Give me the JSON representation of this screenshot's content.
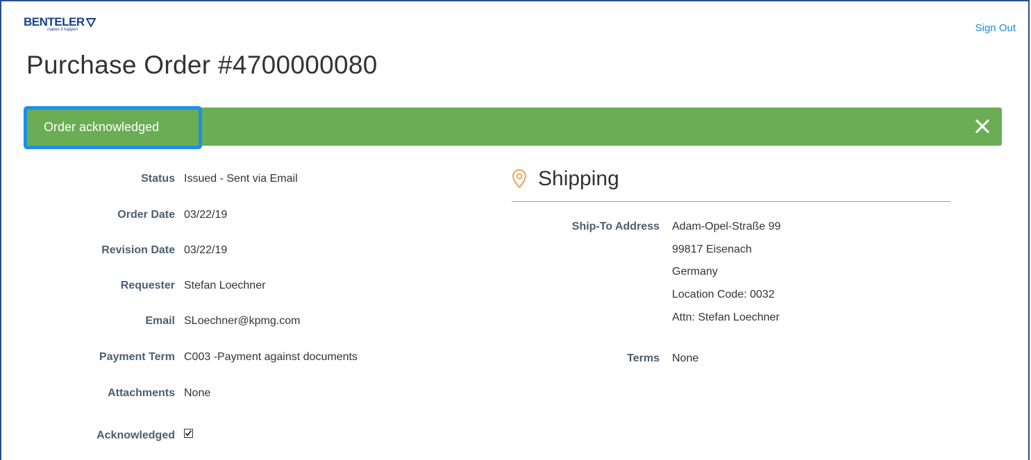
{
  "brand": {
    "name": "BENTELER",
    "tagline": "makes it happen"
  },
  "header": {
    "sign_out": "Sign Out",
    "title": "Purchase Order #4700000080"
  },
  "banner": {
    "message": "Order acknowledged",
    "color": "#6aad55",
    "highlight": "#1d8fe6"
  },
  "details": {
    "status_label": "Status",
    "status": "Issued - Sent via Email",
    "order_date_label": "Order Date",
    "order_date": "03/22/19",
    "revision_date_label": "Revision Date",
    "revision_date": "03/22/19",
    "requester_label": "Requester",
    "requester": "Stefan Loechner",
    "email_label": "Email",
    "email": "SLoechner@kpmg.com",
    "payment_term_label": "Payment Term",
    "payment_term": "C003 -Payment against documents",
    "attachments_label": "Attachments",
    "attachments": "None",
    "acknowledged_label": "Acknowledged",
    "acknowledged": true
  },
  "shipping": {
    "title": "Shipping",
    "ship_to_label": "Ship-To Address",
    "address_lines": [
      "Adam-Opel-Straße 99",
      "99817 Eisenach",
      "Germany",
      "Location Code: 0032",
      "Attn: Stefan Loechner"
    ],
    "terms_label": "Terms",
    "terms": "None"
  },
  "icons": {
    "close": "close-icon",
    "location": "location-pin-icon",
    "checkbox": "checkbox-checked-icon"
  }
}
